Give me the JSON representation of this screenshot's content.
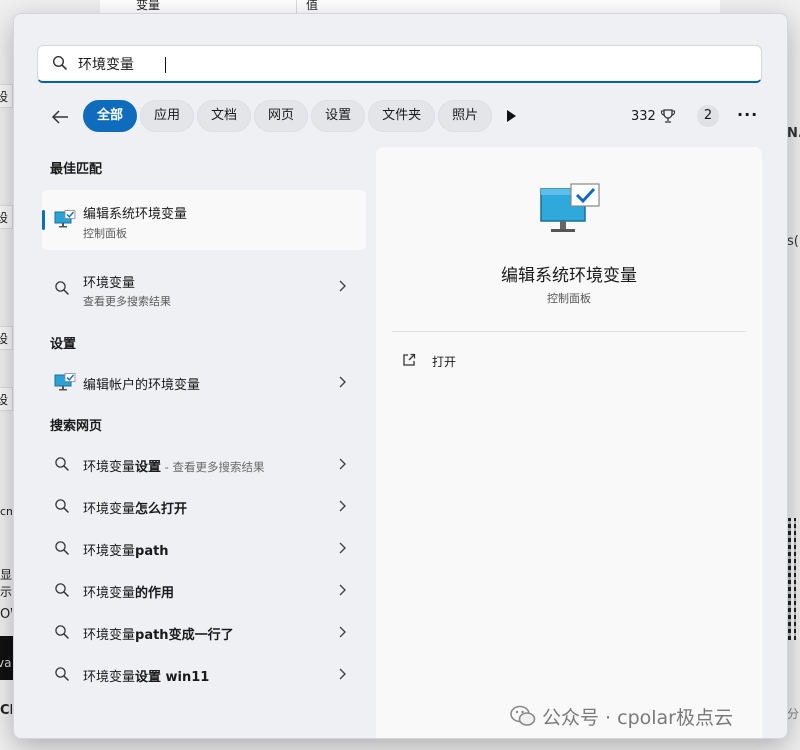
{
  "background": {
    "table_col1": "变量",
    "table_col2": "值",
    "left_frags": [
      "设",
      "设",
      "设",
      "设"
    ],
    "left_misc": [
      "cm",
      "显示",
      "OW",
      "va",
      "CE"
    ],
    "right_frags": [
      "N.",
      "s(L"
    ],
    "right_bottom": "分"
  },
  "search": {
    "query": "环境变量"
  },
  "filters": {
    "chips": [
      "全部",
      "应用",
      "文档",
      "网页",
      "设置",
      "文件夹",
      "照片"
    ],
    "active_index": 0,
    "points": "332",
    "badge": "2",
    "more": "···"
  },
  "results": {
    "best_match_title": "最佳匹配",
    "best_match": {
      "title": "编辑系统环境变量",
      "subtitle": "控制面板"
    },
    "query_item": {
      "title": "环境变量",
      "subtitle": "查看更多搜索结果"
    },
    "settings_title": "设置",
    "settings_item": {
      "title": "编辑帐户的环境变量"
    },
    "web_title": "搜索网页",
    "web_items": [
      {
        "prefix": "环境变量",
        "bold": "设置",
        "hint": " - 查看更多搜索结果"
      },
      {
        "prefix": "环境变量",
        "bold": "怎么打开",
        "hint": ""
      },
      {
        "prefix": "环境变量",
        "bold": "path",
        "hint": ""
      },
      {
        "prefix": "环境变量",
        "bold": "的作用",
        "hint": ""
      },
      {
        "prefix": "环境变量",
        "bold": "path变成一行了",
        "hint": ""
      },
      {
        "prefix": "环境变量",
        "bold": "设置 win11",
        "hint": ""
      }
    ]
  },
  "preview": {
    "title": "编辑系统环境变量",
    "subtitle": "控制面板",
    "action_label": "打开"
  },
  "watermark": "公众号 · cpolar极点云",
  "colors": {
    "accent": "#0f6cbd",
    "panel": "#eef0f3",
    "card": "#f9f9fa"
  }
}
